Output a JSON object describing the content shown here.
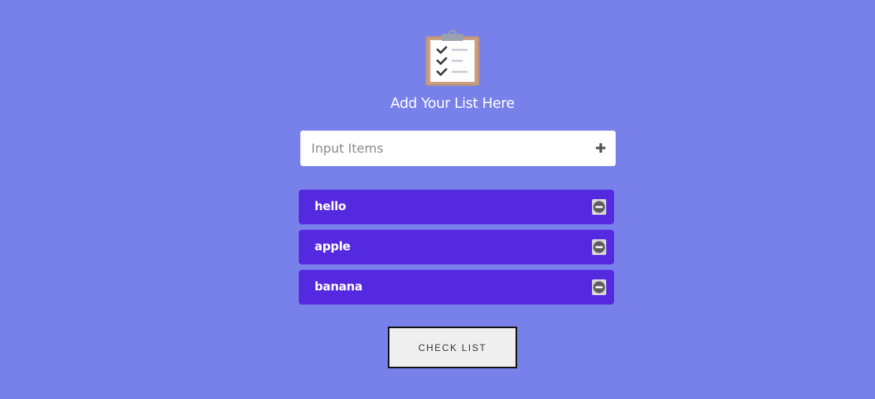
{
  "logo": {
    "icon": "clipboard-checklist-icon"
  },
  "title": "Add Your List Here",
  "input": {
    "placeholder": "Input Items",
    "value": "",
    "add_icon": "plus-icon"
  },
  "items": [
    {
      "label": "hello",
      "remove_icon": "minus-circle-icon"
    },
    {
      "label": "apple",
      "remove_icon": "minus-circle-icon"
    },
    {
      "label": "banana",
      "remove_icon": "minus-circle-icon"
    }
  ],
  "check_button": {
    "label": "CHECK LIST"
  },
  "colors": {
    "background": "#7880ea",
    "item_background": "#5529e0",
    "text": "#ffffff",
    "button_background": "#efefef"
  }
}
